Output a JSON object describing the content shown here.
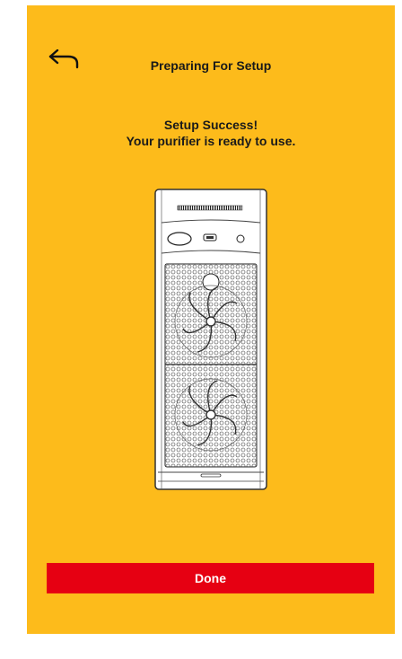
{
  "header": {
    "back_icon": "back-arrow-icon",
    "title": "Preparing For Setup"
  },
  "status": {
    "line1": "Setup Success!",
    "line2": "Your purifier is ready to use."
  },
  "illustration": {
    "icon": "air-purifier-illustration"
  },
  "actions": {
    "done_label": "Done"
  },
  "colors": {
    "background": "#FDBB1B",
    "primary_button": "#E60012",
    "button_text": "#FFFFFF",
    "text": "#1A1A1A"
  }
}
